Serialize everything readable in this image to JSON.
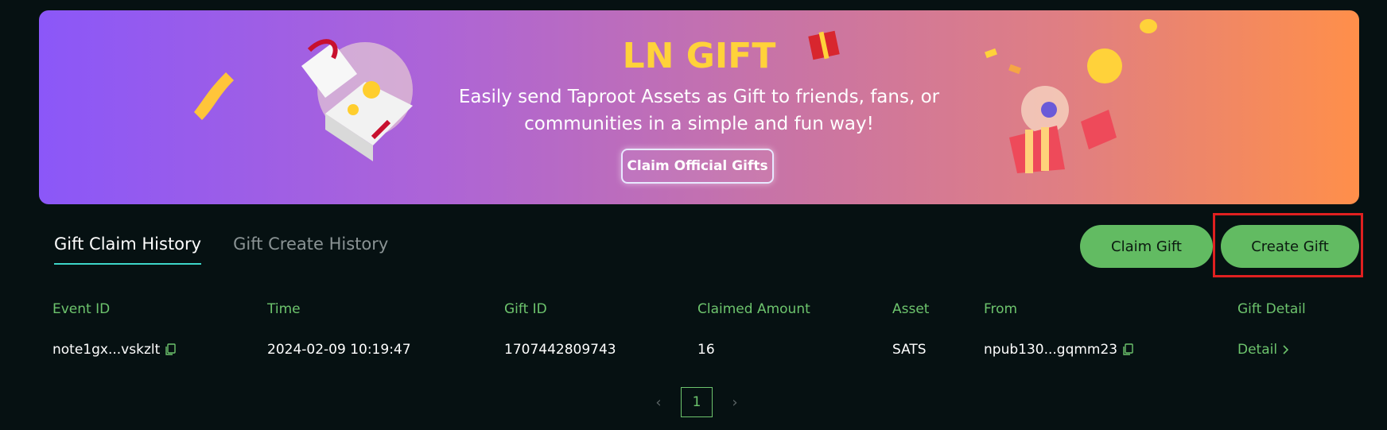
{
  "banner": {
    "title": "LN GIFT",
    "subtitle": "Easily send Taproot Assets as Gift to friends, fans, or communities in a simple and fun way!",
    "button_label": "Claim Official Gifts"
  },
  "tabs": [
    {
      "label": "Gift Claim History",
      "active": true
    },
    {
      "label": "Gift Create History",
      "active": false
    }
  ],
  "actions": {
    "claim_label": "Claim Gift",
    "create_label": "Create Gift"
  },
  "table": {
    "headers": [
      "Event ID",
      "Time",
      "Gift ID",
      "Claimed Amount",
      "Asset",
      "From",
      "Gift Detail"
    ],
    "rows": [
      {
        "event_id": "note1gx...vskzlt",
        "time": "2024-02-09 10:19:47",
        "gift_id": "1707442809743",
        "claimed_amount": "16",
        "asset": "SATS",
        "from": "npub130...gqmm23",
        "detail": "Detail"
      }
    ]
  },
  "pagination": {
    "current_page": "1",
    "prev": "‹",
    "next": "›"
  },
  "colors": {
    "accent_green": "#62bb62",
    "tab_underline": "#3dd6c8",
    "highlight": "#e02020",
    "background": "#061112"
  }
}
